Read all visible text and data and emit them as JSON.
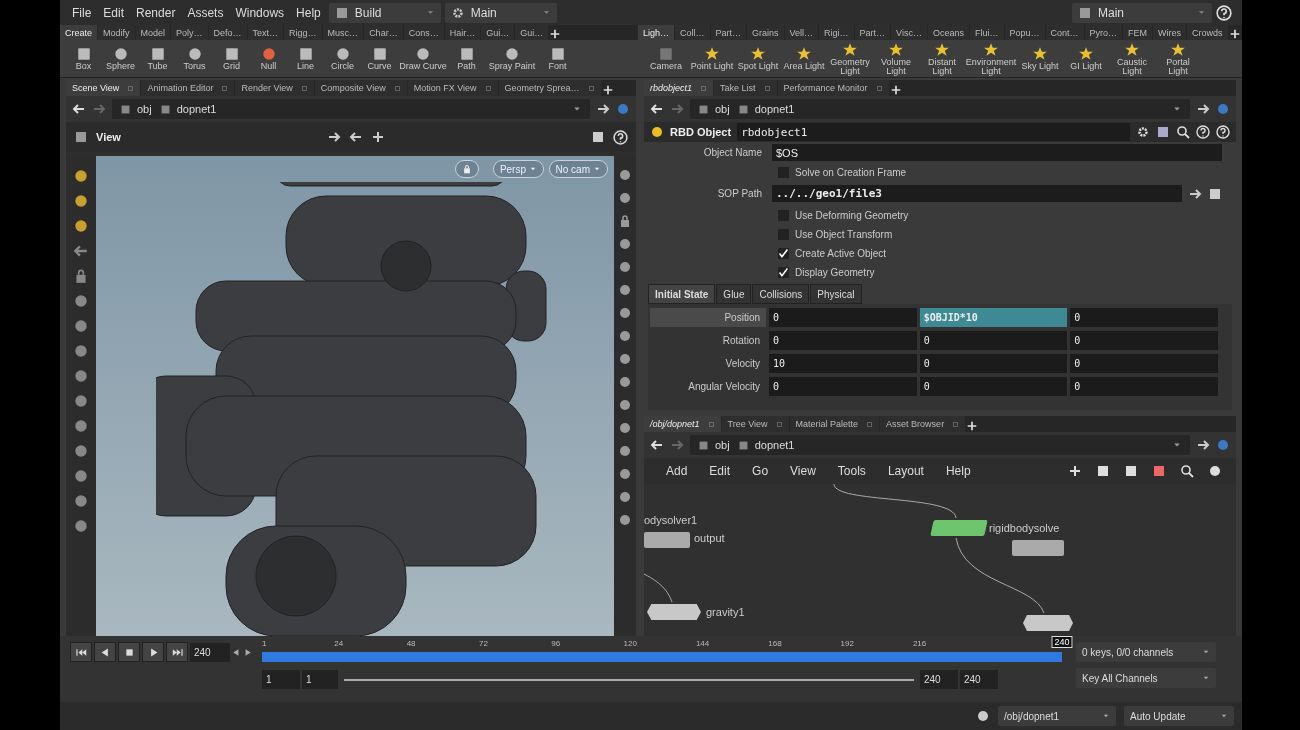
{
  "menu": [
    "File",
    "Edit",
    "Render",
    "Assets",
    "Windows",
    "Help"
  ],
  "desktop": "Build",
  "context": "Main",
  "context_right": "Main",
  "shelf_left": {
    "tabs": [
      {
        "label": "Create",
        "selected": true
      },
      {
        "label": "Modify",
        "selected": false
      },
      {
        "label": "Model",
        "selected": false
      },
      {
        "label": "Poly…",
        "selected": false
      },
      {
        "label": "Defo…",
        "selected": false
      },
      {
        "label": "Text…",
        "selected": false
      },
      {
        "label": "Rigg…",
        "selected": false
      },
      {
        "label": "Musc…",
        "selected": false
      },
      {
        "label": "Char…",
        "selected": false
      },
      {
        "label": "Cons…",
        "selected": false
      },
      {
        "label": "Hair…",
        "selected": false
      },
      {
        "label": "Gui…",
        "selected": false
      },
      {
        "label": "Gui…",
        "selected": false
      }
    ],
    "tools": [
      "Box",
      "Sphere",
      "Tube",
      "Torus",
      "Grid",
      "Null",
      "Line",
      "Circle",
      "Curve",
      "Draw Curve",
      "Path",
      "Spray Paint",
      "Font"
    ]
  },
  "shelf_right": {
    "tabs": [
      {
        "label": "Ligh…",
        "selected": true
      },
      {
        "label": "Coll…",
        "selected": false
      },
      {
        "label": "Part…",
        "selected": false
      },
      {
        "label": "Grains",
        "selected": false
      },
      {
        "label": "Vell…",
        "selected": false
      },
      {
        "label": "Rigi…",
        "selected": false
      },
      {
        "label": "Part…",
        "selected": false
      },
      {
        "label": "Visc…",
        "selected": false
      },
      {
        "label": "Oceans",
        "selected": false
      },
      {
        "label": "Flui…",
        "selected": false
      },
      {
        "label": "Popu…",
        "selected": false
      },
      {
        "label": "Cont…",
        "selected": false
      },
      {
        "label": "Pyro…",
        "selected": false
      },
      {
        "label": "FEM",
        "selected": false
      },
      {
        "label": "Wires",
        "selected": false
      },
      {
        "label": "Crowds",
        "selected": false
      }
    ],
    "tools": [
      "Camera",
      "Point Light",
      "Spot Light",
      "Area Light",
      "Geometry Light",
      "Volume Light",
      "Distant Light",
      "Environment Light",
      "Sky Light",
      "GI Light",
      "Caustic Light",
      "Portal Light"
    ]
  },
  "scene_pane": {
    "tabs": [
      {
        "label": "Scene View",
        "selected": true
      },
      {
        "label": "Animation Editor",
        "selected": false
      },
      {
        "label": "Render View",
        "selected": false
      },
      {
        "label": "Composite View",
        "selected": false
      },
      {
        "label": "Motion FX View",
        "selected": false
      },
      {
        "label": "Geometry Sprea…",
        "selected": false
      }
    ],
    "path": [
      "obj",
      "dopnet1"
    ],
    "view_title": "View",
    "projection": "Persp",
    "camera": "No cam"
  },
  "param_pane": {
    "tabs": [
      {
        "label": "rbdobject1",
        "selected": true
      },
      {
        "label": "Take List",
        "selected": false
      },
      {
        "label": "Performance Monitor",
        "selected": false
      }
    ],
    "path": [
      "obj",
      "dopnet1"
    ],
    "node_type": "RBD Object",
    "node_name": "rbdobject1",
    "params": [
      {
        "kind": "text",
        "label": "Object Name",
        "value": "$OS"
      },
      {
        "kind": "checkbox",
        "label": "Solve on Creation Frame",
        "checked": false
      },
      {
        "kind": "text",
        "label": "SOP Path",
        "value": "../../geo1/file3"
      },
      {
        "kind": "checkbox",
        "label": "Use Deforming Geometry",
        "checked": false
      },
      {
        "kind": "checkbox",
        "label": "Use Object Transform",
        "checked": false
      },
      {
        "kind": "checkbox",
        "label": "Create Active Object",
        "checked": true
      },
      {
        "kind": "checkbox",
        "label": "Display Geometry",
        "checked": true
      }
    ],
    "folders": [
      {
        "label": "Initial State",
        "selected": true
      },
      {
        "label": "Glue",
        "selected": false
      },
      {
        "label": "Collisions",
        "selected": false
      },
      {
        "label": "Physical",
        "selected": false
      }
    ],
    "vectors": [
      {
        "label": "Position",
        "selected": true,
        "values": [
          {
            "text": "0",
            "highlighted": false
          },
          {
            "text": "$OBJID*10",
            "highlighted": true
          },
          {
            "text": "0",
            "highlighted": false
          }
        ]
      },
      {
        "label": "Rotation",
        "selected": false,
        "values": [
          {
            "text": "0",
            "highlighted": false
          },
          {
            "text": "0",
            "highlighted": false
          },
          {
            "text": "0",
            "highlighted": false
          }
        ]
      },
      {
        "label": "Velocity",
        "selected": false,
        "values": [
          {
            "text": "10",
            "highlighted": false
          },
          {
            "text": "0",
            "highlighted": false
          },
          {
            "text": "0",
            "highlighted": false
          }
        ]
      },
      {
        "label": "Angular Velocity",
        "selected": false,
        "values": [
          {
            "text": "0",
            "highlighted": false
          },
          {
            "text": "0",
            "highlighted": false
          },
          {
            "text": "0",
            "highlighted": false
          }
        ]
      }
    ]
  },
  "network_pane": {
    "tabs": [
      {
        "label": "/obj/dopnet1",
        "selected": true
      },
      {
        "label": "Tree View",
        "selected": false
      },
      {
        "label": "Material Palette",
        "selected": false
      },
      {
        "label": "Asset Browser",
        "selected": false
      }
    ],
    "path": [
      "obj",
      "dopnet1"
    ],
    "menu": [
      "Add",
      "Edit",
      "Go",
      "View",
      "Tools",
      "Layout",
      "Help"
    ],
    "nodes": [
      {
        "kind": "output",
        "label": "output"
      },
      {
        "kind": "solver",
        "label": "rigidbodysolve"
      },
      {
        "kind": "force",
        "label": "gravity1"
      },
      {
        "kind": "output"
      },
      {
        "kind": "force"
      }
    ],
    "captions": [
      "odysolver1"
    ]
  },
  "timeline": {
    "frame": "240",
    "ticks": [
      "1",
      "24",
      "48",
      "72",
      "96",
      "120",
      "144",
      "168",
      "192",
      "216"
    ],
    "current": "240",
    "level": 1,
    "range": {
      "level": 1
    },
    "range_start": "1",
    "start": "1",
    "end": "240",
    "range_end": "240",
    "keys": "0 keys, 0/0 channels",
    "key_mode": "Key All Channels"
  },
  "status": {
    "path": "/obj/dopnet1",
    "update": "Auto Update"
  }
}
